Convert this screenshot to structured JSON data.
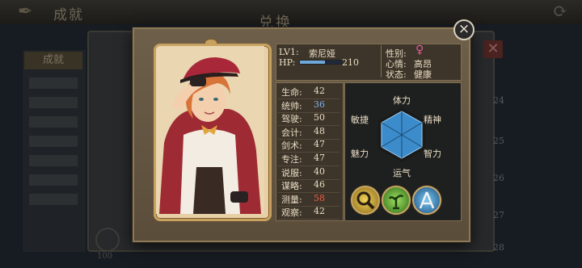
{
  "background": {
    "title": "成就",
    "center_title": "兑换",
    "sidebar_head": "成就",
    "numbers": [
      "24",
      "25",
      "26",
      "27",
      "28"
    ],
    "footer": "100"
  },
  "character": {
    "level_label": "LV1:",
    "name": "索尼娅",
    "hp_label": "HP:",
    "hp_value": "210",
    "hp_fraction": 0.6,
    "gender_label": "性别:",
    "gender_icon": "♀",
    "mood_label": "心情:",
    "mood_value": "高昂",
    "status_label": "状态:",
    "status_value": "健康"
  },
  "stats": [
    {
      "name": "生命:",
      "value": "42",
      "color": "#e9dcc3"
    },
    {
      "name": "统帅:",
      "value": "36",
      "color": "#7fb0e8"
    },
    {
      "name": "驾驶:",
      "value": "50",
      "color": "#e9dcc3"
    },
    {
      "name": "会计:",
      "value": "48",
      "color": "#e9dcc3"
    },
    {
      "name": "剑术:",
      "value": "47",
      "color": "#e9dcc3"
    },
    {
      "name": "专注:",
      "value": "47",
      "color": "#e9dcc3"
    },
    {
      "name": "说服:",
      "value": "40",
      "color": "#e9dcc3"
    },
    {
      "name": "谋略:",
      "value": "46",
      "color": "#e9dcc3"
    },
    {
      "name": "测量:",
      "value": "58",
      "color": "#ef5a4a"
    },
    {
      "name": "观察:",
      "value": "42",
      "color": "#e9dcc3"
    }
  ],
  "radar": {
    "labels": {
      "top": "体力",
      "top_right": "精神",
      "bottom_right": "智力",
      "bottom": "运气",
      "bottom_left": "魅力",
      "top_left": "敏捷"
    },
    "fill_color": "#3c8ccc"
  },
  "skills": [
    {
      "icon": "magnifier-skill-icon",
      "color": "#d8b23a"
    },
    {
      "icon": "plant-skill-icon",
      "color": "#5fb02f"
    },
    {
      "icon": "compass-skill-icon",
      "color": "#2f8cc8"
    }
  ],
  "close_icon": "×"
}
